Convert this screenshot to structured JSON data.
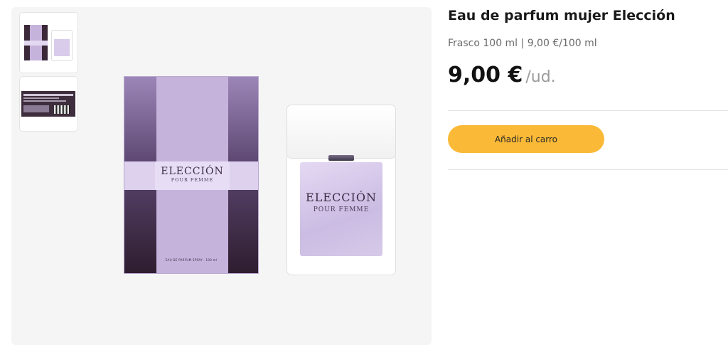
{
  "product": {
    "title": "Eau de parfum mujer Elección",
    "meta": "Frasco 100 ml | 9,00 €/100 ml",
    "price": "9,00 €",
    "price_unit": "/ud.",
    "add_to_cart_label": "Añadir al carro"
  },
  "image": {
    "box_brand": "ELECCIÓN",
    "box_sub": "POUR FEMME",
    "box_footer": "EAU DE PARFUM SPRAY · 100 ml",
    "bottle_brand": "ELECCIÓN",
    "bottle_sub": "POUR FEMME"
  },
  "thumbnails": [
    "front-view",
    "back-label-view"
  ],
  "colors": {
    "button": "#fab936",
    "box_lilac": "#c5b3dc",
    "box_dark": "#2e1d2f"
  }
}
